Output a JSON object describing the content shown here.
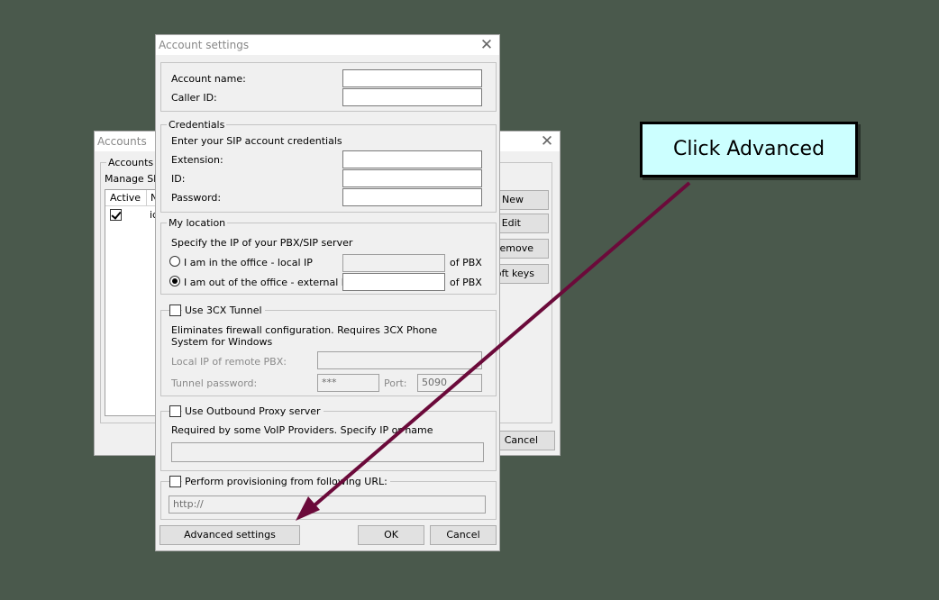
{
  "accounts_window": {
    "title": "Accounts",
    "group_label": "Accounts",
    "manage_text": "Manage SIP",
    "table": {
      "col_active": "Active",
      "col_name": "N",
      "row": {
        "active": true,
        "name": "ic"
      }
    },
    "buttons": {
      "new": "New",
      "edit": "Edit",
      "remove": "Remove",
      "soft_keys": "Soft keys",
      "cancel": "Cancel"
    }
  },
  "account_settings": {
    "title": "Account settings",
    "account_name_label": "Account name:",
    "caller_id_label": "Caller ID:",
    "credentials": {
      "legend": "Credentials",
      "intro": "Enter your SIP account credentials",
      "extension_label": "Extension:",
      "id_label": "ID:",
      "password_label": "Password:"
    },
    "location": {
      "legend": "My location",
      "intro": "Specify the IP of your PBX/SIP server",
      "local_label": "I am in the office - local IP",
      "external_label": "I am out of the office - external IP",
      "of_pbx": "of PBX",
      "selected": "external"
    },
    "tunnel": {
      "label": "Use 3CX Tunnel",
      "checked": false,
      "desc": "Eliminates firewall configuration. Requires 3CX Phone System for Windows",
      "local_ip_label": "Local IP of remote PBX:",
      "tunnel_password_label": "Tunnel password:",
      "tunnel_password_value": "***",
      "port_label": "Port:",
      "port_value": "5090"
    },
    "proxy": {
      "label": "Use Outbound Proxy server",
      "checked": false,
      "desc": "Required by some VoIP Providers. Specify IP or name"
    },
    "provisioning": {
      "label": "Perform provisioning from following URL:",
      "checked": false,
      "url_value": "http://"
    },
    "buttons": {
      "advanced": "Advanced settings",
      "ok": "OK",
      "cancel": "Cancel"
    }
  },
  "callout": {
    "text": "Click Advanced"
  },
  "colors": {
    "arrow": "#6b0a3a",
    "callout_bg": "#ccffff",
    "desktop": "#4a594c"
  }
}
